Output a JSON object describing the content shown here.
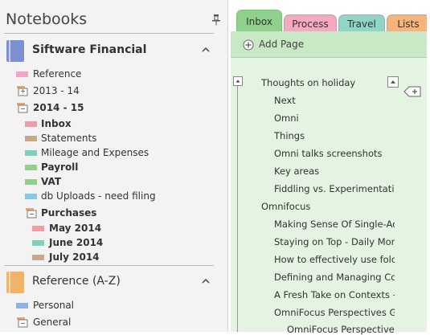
{
  "notebooks_pane": {
    "title": "Notebooks",
    "notebooks": [
      {
        "name": "Siftware Financial",
        "color": "#7b8fd4",
        "sections": [
          {
            "label": "Reference",
            "color": "#f2a6c8",
            "kind": "section",
            "bold": false
          },
          {
            "label": "2013 - 14",
            "kind": "group",
            "bold": false
          },
          {
            "label": "2014 - 15",
            "kind": "group",
            "bold": true
          },
          {
            "label": "Inbox",
            "color": "#f19aa8",
            "kind": "section",
            "bold": true
          },
          {
            "label": "Statements",
            "color": "#c9a88a",
            "kind": "section",
            "bold": false
          },
          {
            "label": "Mileage and Expenses",
            "color": "#7fd1b9",
            "kind": "section",
            "bold": false
          },
          {
            "label": "Payroll",
            "color": "#8fd08a",
            "kind": "section",
            "bold": true
          },
          {
            "label": "VAT",
            "color": "#8fd08a",
            "kind": "section",
            "bold": true
          },
          {
            "label": "db Uploads - need filing",
            "color": "#87c9e6",
            "kind": "section",
            "bold": false
          },
          {
            "label": "Purchases",
            "kind": "group",
            "bold": true
          },
          {
            "label": "May 2014",
            "color": "#f19aa8",
            "kind": "section",
            "bold": true
          },
          {
            "label": "June 2014",
            "color": "#7fd1b9",
            "kind": "section",
            "bold": true
          },
          {
            "label": "July 2014",
            "color": "#c9a88a",
            "kind": "section",
            "bold": true
          }
        ]
      },
      {
        "name": "Reference (A-Z)",
        "color": "#f4b266",
        "sections": [
          {
            "label": "Personal",
            "color": "#8fb0e6",
            "kind": "section",
            "bold": false
          },
          {
            "label": "General",
            "kind": "group",
            "bold": false
          }
        ]
      }
    ]
  },
  "tabs": [
    {
      "label": "Inbox",
      "color": "#8fd08a"
    },
    {
      "label": "Process",
      "color": "#f6a9bf"
    },
    {
      "label": "Travel",
      "color": "#8fd6c8"
    },
    {
      "label": "Lists",
      "color": "#f6b47a"
    }
  ],
  "page_list": {
    "add_page_label": "Add Page",
    "pages": [
      {
        "title": "Thoughts on holiday",
        "level": 0
      },
      {
        "title": "Next",
        "level": 1
      },
      {
        "title": "Omni",
        "level": 1
      },
      {
        "title": "Things",
        "level": 1
      },
      {
        "title": "Omni talks screenshots",
        "level": 1
      },
      {
        "title": "Key areas",
        "level": 1
      },
      {
        "title": "Fiddling vs. Experimentation",
        "level": 1
      },
      {
        "title": "Omnifocus",
        "level": 0
      },
      {
        "title": "Making Sense Of Single-Acti",
        "level": 1
      },
      {
        "title": "Staying on Top - Daily Morn",
        "level": 1
      },
      {
        "title": "How to effectively use folder",
        "level": 1
      },
      {
        "title": "Defining and Managing Con",
        "level": 1
      },
      {
        "title": "A Fresh Take on Contexts – S",
        "level": 1
      },
      {
        "title": "OmniFocus Perspectives Gal",
        "level": 1
      },
      {
        "title": "OmniFocus Perspectives",
        "level": 2
      }
    ]
  }
}
